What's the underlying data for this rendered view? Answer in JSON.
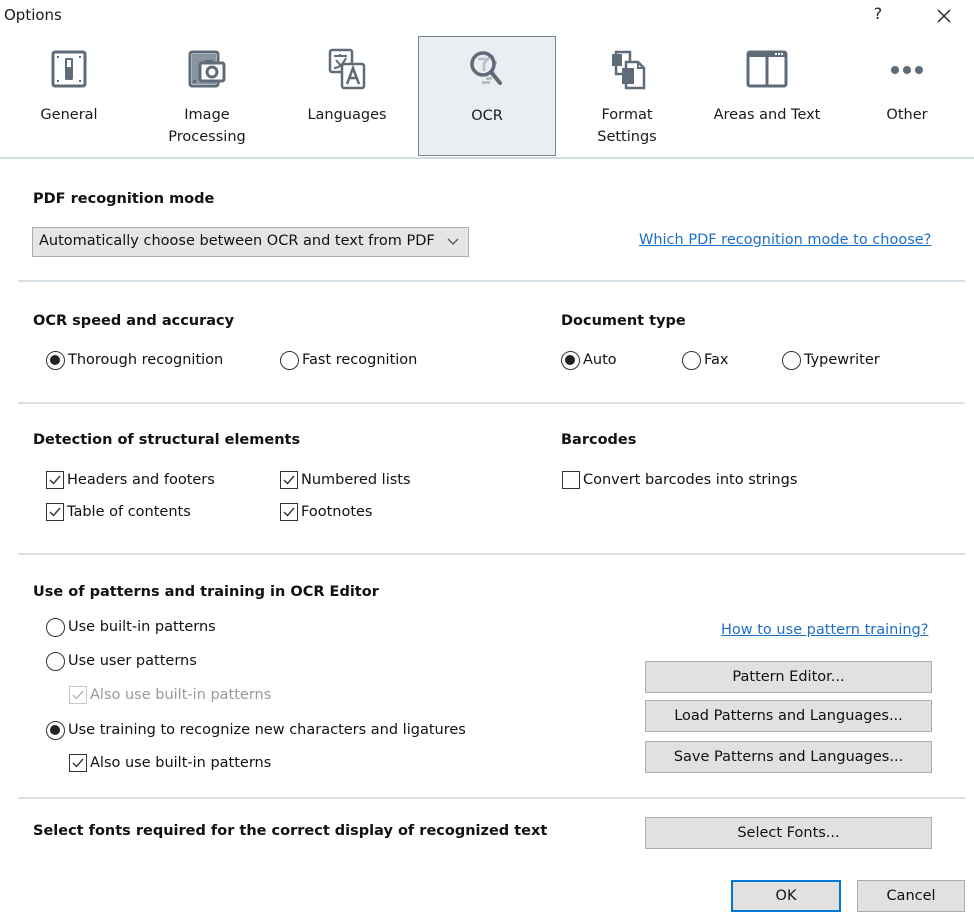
{
  "window": {
    "title": "Options",
    "help_label": "?",
    "close_icon": "close-icon"
  },
  "tabs": [
    {
      "label": "General",
      "icon": "switch-icon",
      "active": false
    },
    {
      "label": "Image Processing",
      "line1": "Image",
      "line2": "Processing",
      "icon": "image-camera-icon",
      "active": false
    },
    {
      "label": "Languages",
      "icon": "translate-icon",
      "active": false
    },
    {
      "label": "OCR",
      "icon": "magnifier-icon",
      "active": true
    },
    {
      "label": "Format Settings",
      "line1": "Format",
      "line2": "Settings",
      "icon": "documents-icon",
      "active": false
    },
    {
      "label": "Areas and Text",
      "icon": "columns-window-icon",
      "active": false
    },
    {
      "label": "Other",
      "icon": "more-dots-icon",
      "active": false
    }
  ],
  "pdf_mode": {
    "heading": "PDF recognition mode",
    "selected": "Automatically choose between OCR and text from PDF",
    "help_link": "Which PDF recognition mode to choose?"
  },
  "speed": {
    "heading": "OCR speed and accuracy",
    "options": [
      {
        "label": "Thorough recognition",
        "checked": true
      },
      {
        "label": "Fast recognition",
        "checked": false
      }
    ]
  },
  "doc_type": {
    "heading": "Document type",
    "options": [
      {
        "label": "Auto",
        "checked": true
      },
      {
        "label": "Fax",
        "checked": false
      },
      {
        "label": "Typewriter",
        "checked": false
      }
    ]
  },
  "structure": {
    "heading": "Detection of structural elements",
    "options": [
      {
        "label": "Headers and footers",
        "checked": true
      },
      {
        "label": "Numbered lists",
        "checked": true
      },
      {
        "label": "Table of contents",
        "checked": true
      },
      {
        "label": "Footnotes",
        "checked": true
      }
    ]
  },
  "barcodes": {
    "heading": "Barcodes",
    "options": [
      {
        "label": "Convert barcodes into strings",
        "checked": false
      }
    ]
  },
  "patterns": {
    "heading": "Use of patterns and training in OCR Editor",
    "help_link": "How to use pattern training?",
    "options": [
      {
        "label": "Use built-in patterns",
        "type": "radio",
        "checked": false
      },
      {
        "label": "Use user patterns",
        "type": "radio",
        "checked": false
      },
      {
        "label": "Also use built-in patterns",
        "type": "checkbox",
        "checked": true,
        "disabled": true
      },
      {
        "label": "Use training to recognize new characters and ligatures",
        "type": "radio",
        "checked": true
      },
      {
        "label": "Also use built-in patterns",
        "type": "checkbox",
        "checked": true,
        "disabled": false
      }
    ],
    "buttons": {
      "editor": "Pattern Editor...",
      "load": "Load Patterns and Languages...",
      "save": "Save Patterns and Languages..."
    }
  },
  "fonts": {
    "heading": "Select fonts required for the correct display of recognized text",
    "button": "Select Fonts..."
  },
  "footer": {
    "ok": "OK",
    "cancel": "Cancel"
  },
  "colors": {
    "link": "#1d6fc6",
    "focus_border": "#0078d7",
    "active_tab_bg": "#eaeef1",
    "icon": "#5f6b78"
  }
}
